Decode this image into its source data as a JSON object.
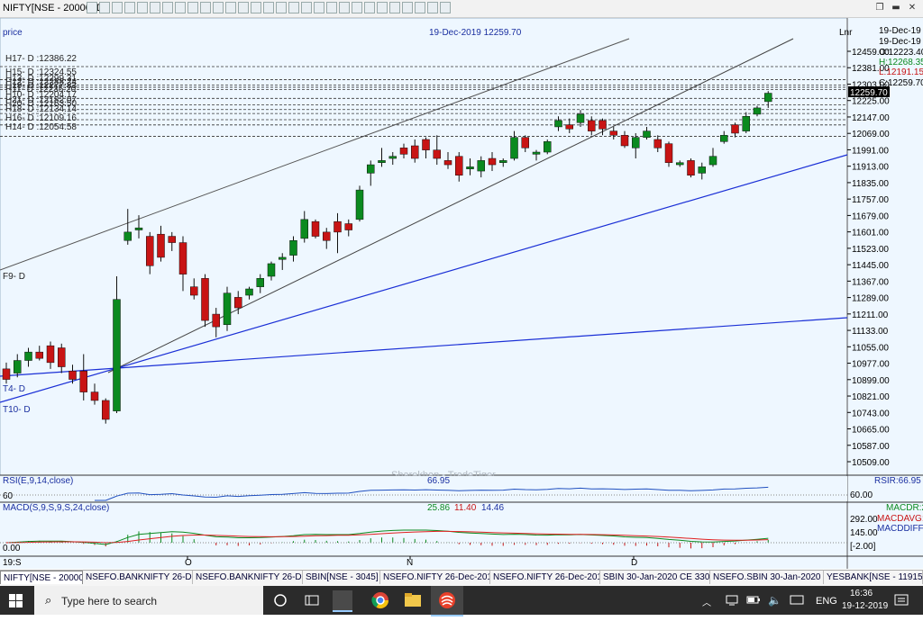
{
  "window": {
    "title": "NIFTY[NSE - 20000] D"
  },
  "toolbar_icons": [
    "zoom-in-icon",
    "zoom-out-icon",
    "crosshair-icon",
    "line-tool-icon",
    "horizontal-line-icon",
    "trendline-icon",
    "channel-icon",
    "fibonacci-icon",
    "text-tool-icon",
    "arrow-tool-icon",
    "rectangle-icon",
    "ellipse-icon",
    "magnifier-icon",
    "pan-icon",
    "undo-icon",
    "redo-icon",
    "refresh-icon",
    "print-icon",
    "copy-icon",
    "chart-properties-icon",
    "indicator-icon",
    "compare-icon",
    "template-icon",
    "grid-icon",
    "zoom-area-icon",
    "reset-zoom-icon",
    "delete-icon",
    "settings-icon",
    "help-icon"
  ],
  "chart": {
    "panel_label": "price",
    "header_info": "19-Dec-2019 12259.70",
    "scale_mode": "Lnr",
    "watermark": "Sharekhan - TradeTiger",
    "right_info": {
      "date1": "19-Dec-19",
      "date2": "19-Dec-19",
      "o": "O:12223.40",
      "h": "H:12268.35",
      "l": "L:12191.15",
      "c": "C:12259.70"
    },
    "last_price": "12259.70",
    "level_labels": [
      "H17- D :12386.22",
      "H15- D :12324.55",
      "H14- D :12054.58",
      "H16- D :12109.16",
      "H18- D :12134.14"
    ],
    "obscured_labels": [
      "H13- D :12299.31",
      "H12- D :12288.24",
      "H19- D :12277.83",
      "H11- D :12235.20",
      "H10- D :12204.17",
      "H21- D :12182.07",
      "H20- D :12163.50"
    ],
    "line_labels": {
      "f9": "F9- D",
      "t4": "T4- D",
      "t10": "T10- D"
    },
    "x_labels": [
      "19:S",
      "O",
      "N",
      "D"
    ],
    "price_ticks": [
      "12459.00",
      "12381.00",
      "12303.00",
      "12225.00",
      "12147.00",
      "12069.00",
      "11991.00",
      "11913.00",
      "11835.00",
      "11757.00",
      "11679.00",
      "11601.00",
      "11523.00",
      "11445.00",
      "11367.00",
      "11289.00",
      "11211.00",
      "11133.00",
      "11055.00",
      "10977.00",
      "10899.00",
      "10821.00",
      "10743.00",
      "10665.00",
      "10587.00",
      "10509.00"
    ],
    "rsi": {
      "label": "RSI(E,9,14,close)",
      "value": "66.95",
      "right_label": "RSIR:66.95",
      "level": "60",
      "right_tick": "60.00"
    },
    "macd": {
      "label": "MACD(S,9,S,9,S,24,close)",
      "v1": "25.86",
      "v2": "11.40",
      "v3": "14.46",
      "ticks": [
        "292.00",
        "145.00",
        "[-2.00]"
      ],
      "zero": "0.00",
      "right1": "MACDR:25.",
      "right2": "MACDAVG:",
      "right3": "MACDDIFF:"
    }
  },
  "colors": {
    "bull": "#0b8a1f",
    "bear": "#c81414",
    "bg": "#eef7ff",
    "blue_line": "#1a2fd6",
    "signal": "#e02020"
  },
  "chart_data": {
    "type": "candlestick",
    "x_labels": [
      "19:S",
      "O",
      "N",
      "D"
    ],
    "candles": [
      [
        10950,
        10980,
        10880,
        10900
      ],
      [
        10930,
        11020,
        10910,
        10990
      ],
      [
        10990,
        11050,
        10960,
        11030
      ],
      [
        11030,
        11060,
        10990,
        11000
      ],
      [
        11060,
        11080,
        10950,
        10980
      ],
      [
        11050,
        11070,
        10930,
        10960
      ],
      [
        10940,
        10970,
        10880,
        10900
      ],
      [
        10940,
        11020,
        10800,
        10840
      ],
      [
        10840,
        10880,
        10780,
        10800
      ],
      [
        10800,
        10810,
        10690,
        10710
      ],
      [
        10750,
        11390,
        10740,
        11280
      ],
      [
        11560,
        11710,
        11540,
        11600
      ],
      [
        11610,
        11680,
        11570,
        11620
      ],
      [
        11580,
        11600,
        11400,
        11440
      ],
      [
        11590,
        11630,
        11460,
        11480
      ],
      [
        11580,
        11600,
        11510,
        11550
      ],
      [
        11550,
        11580,
        11320,
        11400
      ],
      [
        11340,
        11380,
        11280,
        11300
      ],
      [
        11380,
        11400,
        11150,
        11180
      ],
      [
        11210,
        11240,
        11100,
        11150
      ],
      [
        11160,
        11340,
        11130,
        11310
      ],
      [
        11290,
        11320,
        11210,
        11240
      ],
      [
        11300,
        11340,
        11280,
        11330
      ],
      [
        11340,
        11400,
        11310,
        11380
      ],
      [
        11390,
        11460,
        11370,
        11450
      ],
      [
        11470,
        11500,
        11420,
        11480
      ],
      [
        11490,
        11580,
        11460,
        11560
      ],
      [
        11570,
        11700,
        11550,
        11660
      ],
      [
        11650,
        11660,
        11570,
        11580
      ],
      [
        11600,
        11620,
        11520,
        11560
      ],
      [
        11650,
        11690,
        11500,
        11600
      ],
      [
        11640,
        11660,
        11580,
        11610
      ],
      [
        11660,
        11820,
        11650,
        11800
      ],
      [
        11880,
        11940,
        11820,
        11920
      ],
      [
        11930,
        12000,
        11910,
        11940
      ],
      [
        11950,
        11980,
        11920,
        11960
      ],
      [
        12000,
        12020,
        11950,
        11970
      ],
      [
        12010,
        12040,
        11930,
        11950
      ],
      [
        12040,
        12050,
        11950,
        11990
      ],
      [
        11990,
        12060,
        11920,
        11950
      ],
      [
        11940,
        11980,
        11900,
        11920
      ],
      [
        11960,
        11980,
        11840,
        11870
      ],
      [
        11900,
        11950,
        11870,
        11910
      ],
      [
        11890,
        11960,
        11860,
        11940
      ],
      [
        11950,
        11980,
        11890,
        11920
      ],
      [
        11930,
        11950,
        11910,
        11940
      ],
      [
        11950,
        12080,
        11940,
        12050
      ],
      [
        12050,
        12060,
        11980,
        12000
      ],
      [
        11970,
        11990,
        11940,
        11980
      ],
      [
        11980,
        12040,
        11970,
        12030
      ],
      [
        12100,
        12150,
        12080,
        12130
      ],
      [
        12110,
        12140,
        12070,
        12090
      ],
      [
        12120,
        12180,
        12100,
        12160
      ],
      [
        12130,
        12150,
        12060,
        12080
      ],
      [
        12130,
        12140,
        12060,
        12090
      ],
      [
        12080,
        12100,
        12040,
        12060
      ],
      [
        12060,
        12080,
        12000,
        12010
      ],
      [
        12000,
        12070,
        11950,
        12050
      ],
      [
        12050,
        12100,
        12040,
        12080
      ],
      [
        12040,
        12060,
        11980,
        12000
      ],
      [
        12020,
        12030,
        11910,
        11930
      ],
      [
        11920,
        11940,
        11910,
        11930
      ],
      [
        11940,
        11950,
        11860,
        11870
      ],
      [
        11880,
        11930,
        11850,
        11910
      ],
      [
        11920,
        12000,
        11910,
        11960
      ],
      [
        12030,
        12080,
        12020,
        12060
      ],
      [
        12110,
        12120,
        12050,
        12070
      ],
      [
        12080,
        12170,
        12070,
        12150
      ],
      [
        12160,
        12200,
        12150,
        12190
      ],
      [
        12220,
        12270,
        12190,
        12260
      ]
    ]
  }
}
